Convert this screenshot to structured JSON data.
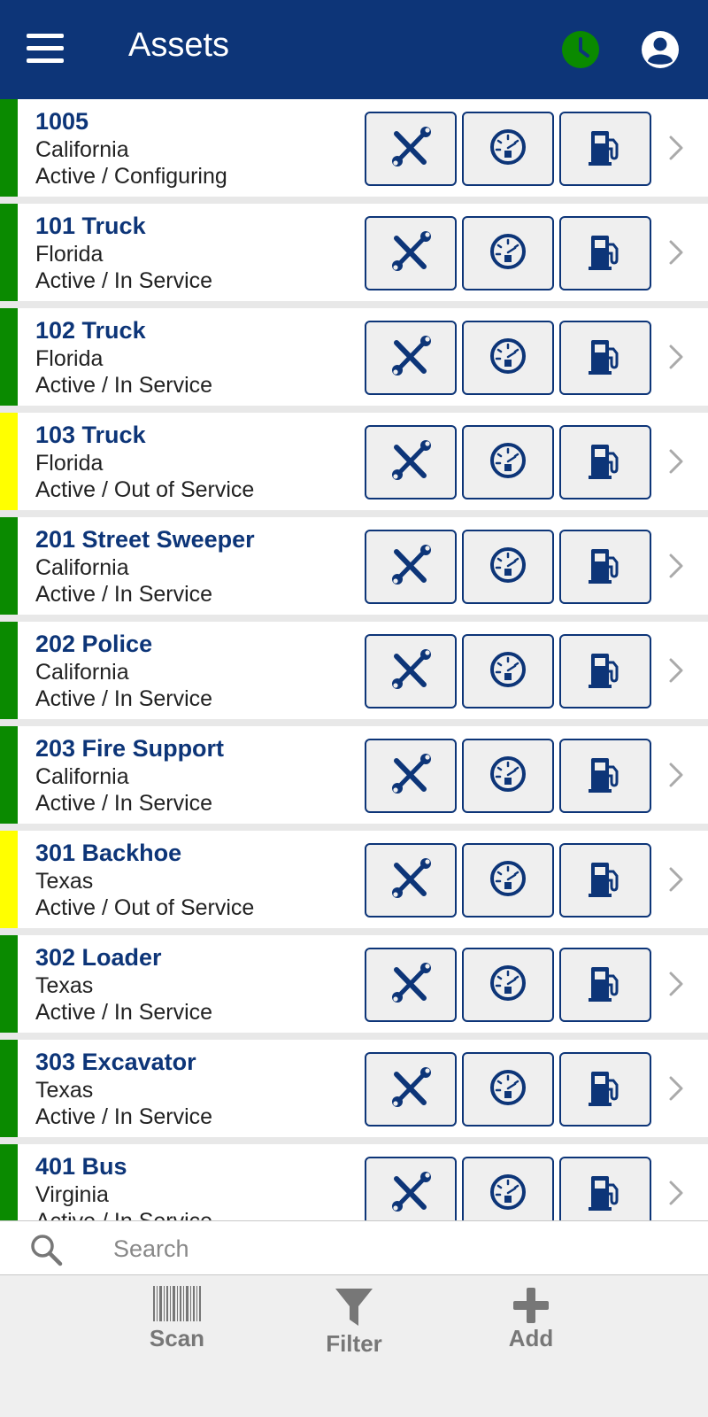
{
  "header": {
    "title": "Assets"
  },
  "colors": {
    "header_bg": "#0d3578",
    "active_ok": "#0a8a00",
    "out_of_service": "#ffff00",
    "clock": "#0a8a00"
  },
  "assets": [
    {
      "name": "1005",
      "location": "California",
      "status": "Active / Configuring",
      "status_color": "#0a8a00"
    },
    {
      "name": "101 Truck",
      "location": "Florida",
      "status": "Active / In Service",
      "status_color": "#0a8a00"
    },
    {
      "name": "102 Truck",
      "location": "Florida",
      "status": "Active / In Service",
      "status_color": "#0a8a00"
    },
    {
      "name": "103 Truck",
      "location": "Florida",
      "status": "Active / Out of Service",
      "status_color": "#ffff00"
    },
    {
      "name": "201 Street Sweeper",
      "location": "California",
      "status": "Active / In Service",
      "status_color": "#0a8a00"
    },
    {
      "name": "202 Police",
      "location": "California",
      "status": "Active / In Service",
      "status_color": "#0a8a00"
    },
    {
      "name": "203 Fire Support",
      "location": "California",
      "status": "Active / In Service",
      "status_color": "#0a8a00"
    },
    {
      "name": "301 Backhoe",
      "location": "Texas",
      "status": "Active / Out of Service",
      "status_color": "#ffff00"
    },
    {
      "name": "302 Loader",
      "location": "Texas",
      "status": "Active / In Service",
      "status_color": "#0a8a00"
    },
    {
      "name": "303 Excavator",
      "location": "Texas",
      "status": "Active / In Service",
      "status_color": "#0a8a00"
    },
    {
      "name": "401 Bus",
      "location": "Virginia",
      "status": "Active / In Service",
      "status_color": "#0a8a00"
    }
  ],
  "row_actions": [
    "wrench-screwdriver-icon",
    "speedometer-icon",
    "fuel-pump-icon"
  ],
  "search": {
    "placeholder": "Search",
    "value": ""
  },
  "toolbar": {
    "scan_label": "Scan",
    "filter_label": "Filter",
    "add_label": "Add"
  }
}
